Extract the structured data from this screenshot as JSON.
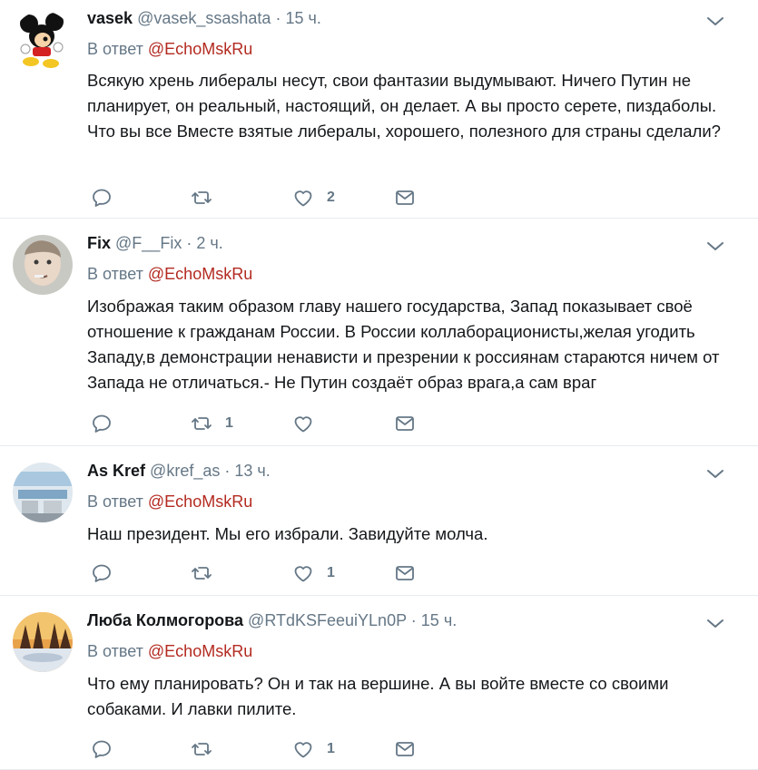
{
  "tweets": [
    {
      "name": "vasek",
      "handle": "@vasek_ssashata",
      "dot": "·",
      "time": "15 ч.",
      "reply_prefix": "В ответ",
      "reply_handle": "@EchoMskRu",
      "text": "Всякую хрень либералы несут, свои фантазии выдумывают. Ничего Путин не планирует, он реальный, настоящий, он делает. А вы просто серете, пиздаболы. Что вы все Вместе взятые либералы, хорошего, полезного для страны сделали?",
      "retweets": "",
      "likes": "2",
      "avatar_icon": "mickey-mouse-avatar"
    },
    {
      "name": "Fix",
      "handle": "@F__Fix",
      "dot": "·",
      "time": "2 ч.",
      "reply_prefix": "В ответ",
      "reply_handle": "@EchoMskRu",
      "text": "Изображая таким образом главу нашего государства, Запад показывает своё отношение к гражданам России. В России коллаборационисты,желая угодить Западу,в демонстрации ненависти и презрении к россиянам стараются ничем от Запада не отличаться.- Не Путин создаёт образ врага,а сам враг",
      "retweets": "1",
      "likes": "",
      "avatar_icon": "child-photo-avatar"
    },
    {
      "name": "As Kref",
      "handle": "@kref_as",
      "dot": "·",
      "time": "13 ч.",
      "reply_prefix": "В ответ",
      "reply_handle": "@EchoMskRu",
      "text": "Наш президент. Мы его избрали. Завидуйте молча.",
      "retweets": "",
      "likes": "1",
      "avatar_icon": "interior-photo-avatar"
    },
    {
      "name": "Люба Колмогорова",
      "handle": "@RTdKSFeeuiYLn0P",
      "dot": "·",
      "time": "15 ч.",
      "reply_prefix": "В ответ",
      "reply_handle": "@EchoMskRu",
      "text": "Что ему планировать? Он и так на вершине. А вы войте вместе со своими собаками. И лавки пилите.",
      "retweets": "",
      "likes": "1",
      "avatar_icon": "winter-forest-avatar"
    }
  ],
  "colors": {
    "text": "#14171a",
    "muted": "#657786",
    "link": "#b32a20",
    "divider": "#e6ecf0"
  }
}
